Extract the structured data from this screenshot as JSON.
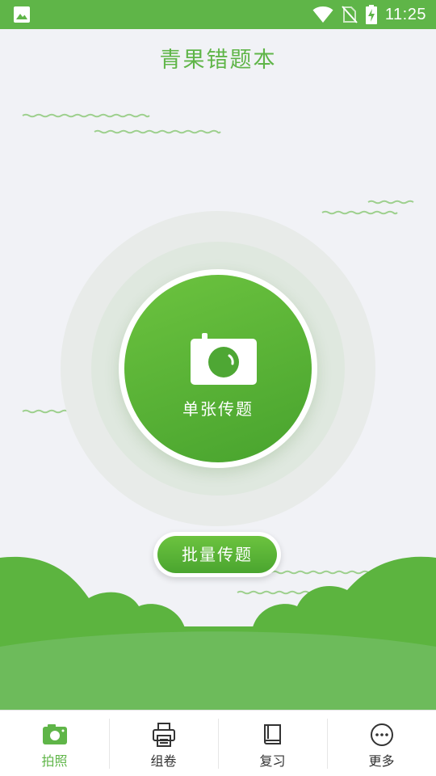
{
  "status_bar": {
    "time": "11:25",
    "icons": [
      "image-icon",
      "wifi-icon",
      "no-sim-icon",
      "battery-charging-icon"
    ]
  },
  "app": {
    "title": "青果错题本"
  },
  "main": {
    "single_label": "单张传题",
    "single_icon": "camera-icon",
    "batch_label": "批量传题"
  },
  "bottom_nav": {
    "items": [
      {
        "label": "拍照",
        "icon": "camera-icon",
        "active": true
      },
      {
        "label": "组卷",
        "icon": "printer-icon",
        "active": false
      },
      {
        "label": "复习",
        "icon": "book-icon",
        "active": false
      },
      {
        "label": "更多",
        "icon": "more-icon",
        "active": false
      }
    ]
  },
  "colors": {
    "primary": "#5fb548",
    "background": "#f1f2f6",
    "hill_dark": "#5cb43f",
    "hill_light": "#6dbb5b"
  }
}
